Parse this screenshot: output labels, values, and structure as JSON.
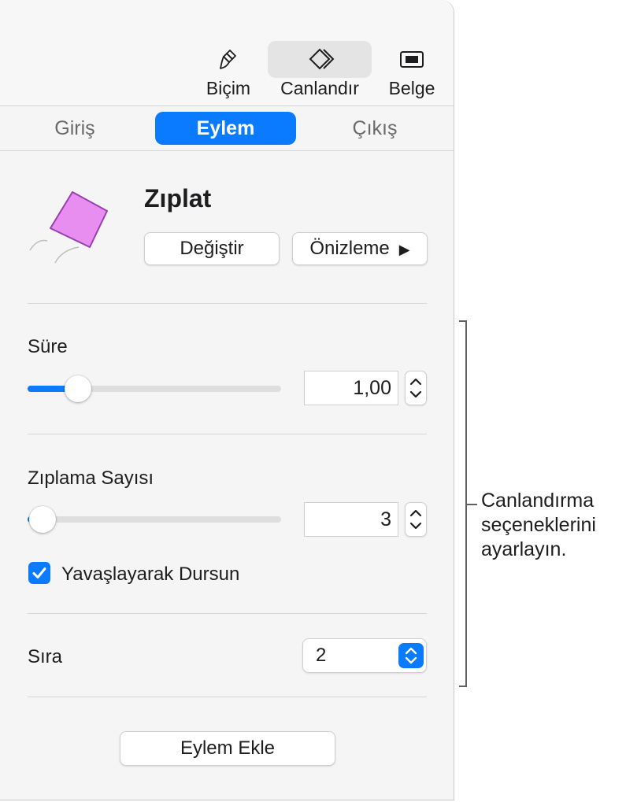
{
  "toolbar": {
    "format_label": "Biçim",
    "animate_label": "Canlandır",
    "document_label": "Belge",
    "format_icon": "paintbrush-icon",
    "animate_icon": "diamond-icon",
    "document_icon": "document-icon",
    "selected": "Canlandır"
  },
  "tabs": {
    "in": "Giriş",
    "action": "Eylem",
    "out": "Çıkış",
    "selected": "Eylem"
  },
  "animation": {
    "name": "Zıplat",
    "thumbnail_icon": "bounce-diamond-thumbnail",
    "change_label": "Değiştir",
    "preview_label": "Önizleme",
    "preview_icon": "▶"
  },
  "duration": {
    "label": "Süre",
    "value": "1,00",
    "slider_fraction": 0.2
  },
  "bounce_count": {
    "label": "Zıplama Sayısı",
    "value": "3",
    "slider_fraction": 0.06
  },
  "ease_out": {
    "label": "Yavaşlayarak Dursun",
    "checked": true
  },
  "order": {
    "label": "Sıra",
    "value": "2"
  },
  "add_action_label": "Eylem Ekle",
  "callout": {
    "lines": [
      "Canlandırma",
      "seçeneklerini",
      "ayarlayın."
    ]
  },
  "colors": {
    "accent": "#0a7aff",
    "thumbnail_fill": "#e88ef0"
  }
}
